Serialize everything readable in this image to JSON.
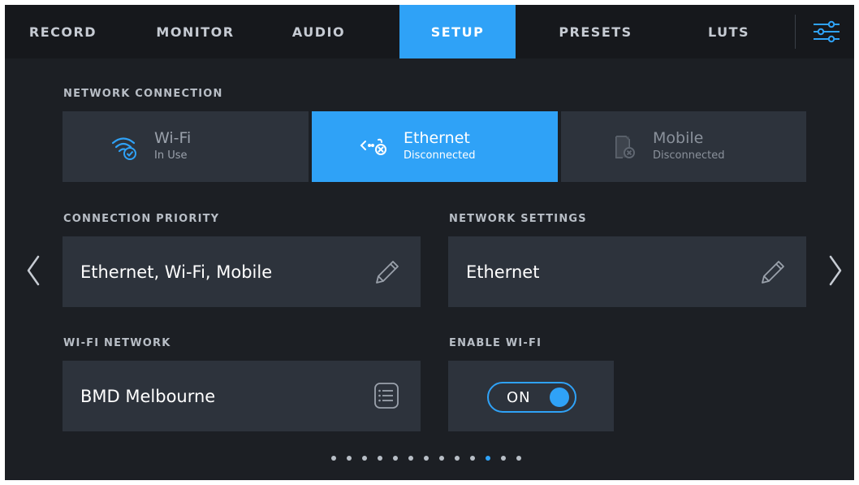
{
  "tabs": [
    {
      "label": "RECORD",
      "active": false
    },
    {
      "label": "MONITOR",
      "active": false
    },
    {
      "label": "AUDIO",
      "active": false
    },
    {
      "label": "SETUP",
      "active": true
    },
    {
      "label": "PRESETS",
      "active": false
    },
    {
      "label": "LUTS",
      "active": false
    }
  ],
  "menu_icon": "sliders-icon",
  "network_connection": {
    "label": "NETWORK CONNECTION",
    "options": [
      {
        "title": "Wi-Fi",
        "status": "In Use",
        "icon": "wifi-check-icon",
        "selected": false
      },
      {
        "title": "Ethernet",
        "status": "Disconnected",
        "icon": "ethernet-disconnected-icon",
        "selected": true
      },
      {
        "title": "Mobile",
        "status": "Disconnected",
        "icon": "mobile-disconnected-icon",
        "selected": false
      }
    ]
  },
  "connection_priority": {
    "label": "CONNECTION PRIORITY",
    "value": "Ethernet, Wi-Fi, Mobile",
    "icon": "pencil-icon"
  },
  "network_settings": {
    "label": "NETWORK SETTINGS",
    "value": "Ethernet",
    "icon": "pencil-icon"
  },
  "wifi_network": {
    "label": "WI-FI NETWORK",
    "value": "BMD Melbourne",
    "icon": "list-icon"
  },
  "enable_wifi": {
    "label": "ENABLE WI-FI",
    "state": "ON"
  },
  "pagination": {
    "total": 13,
    "current": 11
  },
  "colors": {
    "accent": "#2fa2f7",
    "background": "#1c1f24",
    "tabbar": "#16181c",
    "panel": "#2d333c",
    "label": "#b8bec6"
  }
}
